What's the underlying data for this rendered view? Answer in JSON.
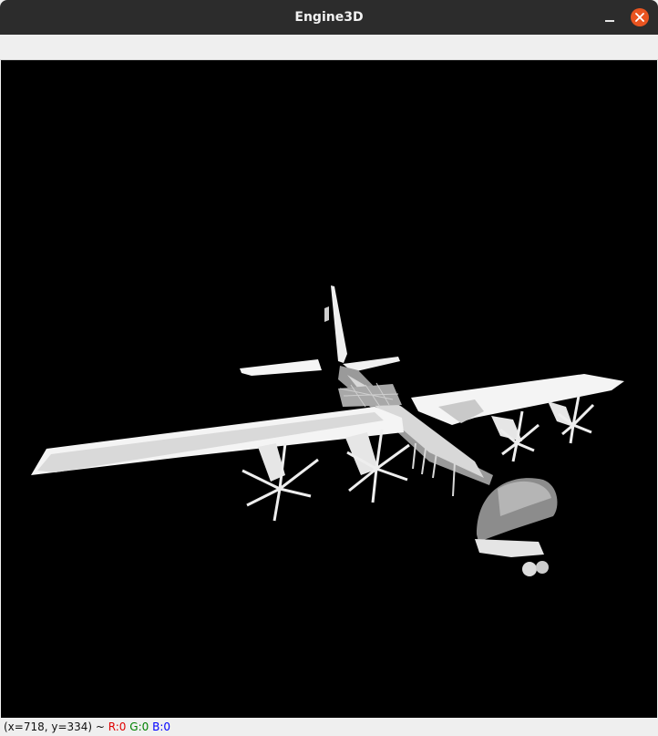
{
  "window": {
    "title": "Engine3D"
  },
  "status": {
    "coords": "(x=718, y=334) ~ ",
    "r_label": "R:0",
    "g_label": "G:0",
    "b_label": "B:0",
    "r_color": "#e00000",
    "g_color": "#008000",
    "b_color": "#0000ff"
  },
  "viewport": {
    "background": "#000000",
    "model_fill": "#f2f2f2"
  },
  "icons": {
    "minimize": "minimize-icon",
    "close": "close-icon"
  }
}
